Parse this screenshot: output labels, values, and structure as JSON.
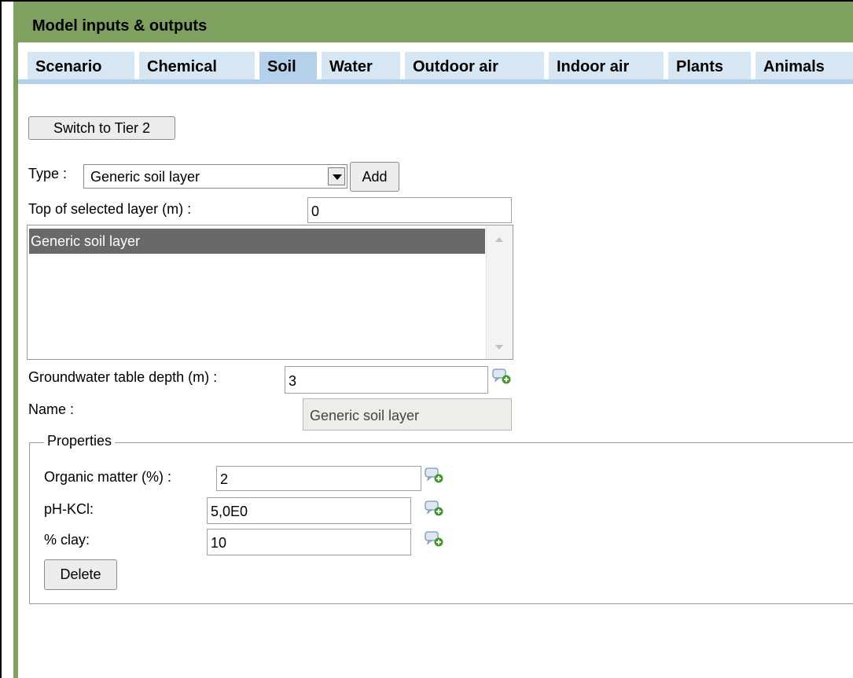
{
  "header": {
    "title": "Model inputs & outputs"
  },
  "tabs": [
    {
      "label": "Scenario"
    },
    {
      "label": "Chemical"
    },
    {
      "label": "Soil"
    },
    {
      "label": "Water"
    },
    {
      "label": "Outdoor air"
    },
    {
      "label": "Indoor air"
    },
    {
      "label": "Plants"
    },
    {
      "label": "Animals"
    }
  ],
  "active_tab": "Soil",
  "soil": {
    "switch_tier_label": "Switch to Tier 2",
    "type_label": "Type :",
    "type_value": "Generic soil layer",
    "add_label": "Add",
    "top_layer_label": "Top of selected layer (m) :",
    "top_layer_value": "0",
    "layers": [
      "Generic soil layer"
    ],
    "groundwater_label": "Groundwater table depth (m) :",
    "groundwater_value": "3",
    "name_label": "Name :",
    "name_value": "Generic soil layer",
    "properties_legend": "Properties",
    "organic_label": "Organic matter (%) :",
    "organic_value": "2",
    "ph_label": "pH-KCl:",
    "ph_value": "5,0E0",
    "clay_label": "% clay:",
    "clay_value": "10",
    "delete_label": "Delete"
  },
  "icons": {
    "comment_add": "comment-add-icon"
  },
  "colors": {
    "header_green": "#7ea160",
    "tab_bg": "#d7e6f3",
    "tab_active": "#b5d0ea",
    "selected_row": "#696969"
  }
}
